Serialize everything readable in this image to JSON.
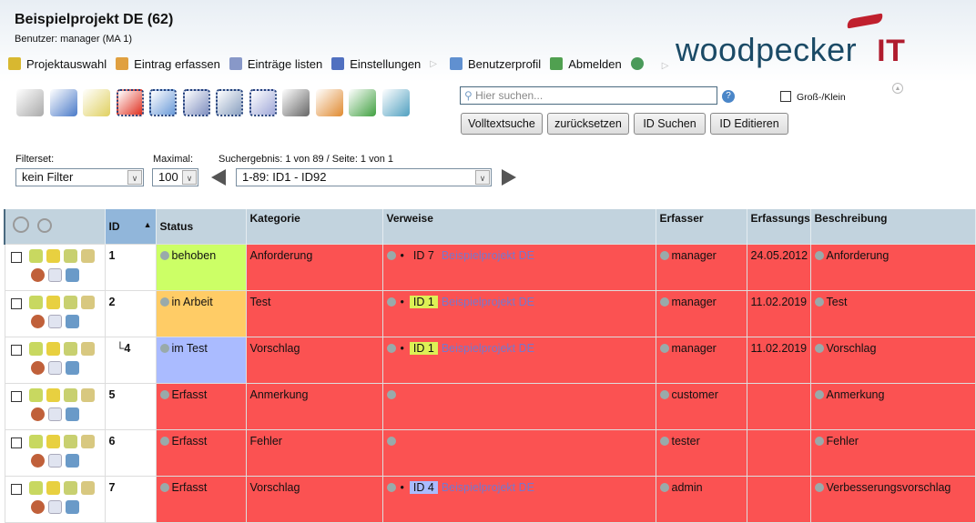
{
  "header": {
    "title": "Beispielprojekt DE (62)",
    "user": "Benutzer: manager (MA 1)",
    "logo_text": "woodpecker",
    "logo_suffix": "IT"
  },
  "menu": [
    {
      "label": "Projektauswahl",
      "icon": "folder-icon"
    },
    {
      "label": "Eintrag erfassen",
      "icon": "add-entry-icon"
    },
    {
      "label": "Einträge listen",
      "icon": "grid-icon"
    },
    {
      "label": "Einstellungen",
      "icon": "settings-icon"
    },
    {
      "label": "Benutzerprofil",
      "icon": "profile-icon"
    },
    {
      "label": "Abmelden",
      "icon": "logout-icon"
    }
  ],
  "toolbar": [
    "filter-icon",
    "select-icon",
    "edit-icon",
    "delete-icon",
    "attach-icon",
    "copy-icon",
    "print-icon",
    "mail-icon",
    "mailbox-icon",
    "import-icon",
    "export-icon",
    "chart-icon"
  ],
  "search": {
    "placeholder": "Hier suchen...",
    "case_label": "Groß-/Klein",
    "buttons": [
      "Volltextsuche",
      "zurücksetzen",
      "ID Suchen",
      "ID Editieren"
    ]
  },
  "filters": {
    "filterset_label": "Filterset:",
    "filterset_value": "kein Filter",
    "max_label": "Maximal:",
    "max_value": "100",
    "result_label": "Suchergebnis:  1 von 89 / Seite: 1 von 1",
    "range_value": "1-89: ID1 - ID92"
  },
  "table": {
    "columns": [
      "ID",
      "Status",
      "Kategorie",
      "Verweise",
      "Erfasser",
      "Erfassungs",
      "Beschreibung"
    ],
    "sort_indicator": "▲",
    "rows": [
      {
        "id": "1",
        "status": "behoben",
        "status_color": "#ccff66",
        "kategorie": "Anforderung",
        "ref_id": "ID 7",
        "ref_color": "",
        "ref_project": "Beispielprojekt DE",
        "erfasser": "manager",
        "datum": "24.05.2012",
        "beschreibung": "Anforderung"
      },
      {
        "id": "2",
        "status": "in Arbeit",
        "status_color": "#ffcc66",
        "kategorie": "Test",
        "ref_id": "ID 1",
        "ref_color": "#ddf055",
        "ref_project": "Beispielprojekt DE",
        "erfasser": "manager",
        "datum": "11.02.2019",
        "beschreibung": "Test"
      },
      {
        "id": "└4",
        "status": "im Test",
        "status_color": "#aabbff",
        "kategorie": "Vorschlag",
        "ref_id": "ID 1",
        "ref_color": "#ddf055",
        "ref_project": "Beispielprojekt DE",
        "erfasser": "manager",
        "datum": "11.02.2019",
        "beschreibung": "Vorschlag"
      },
      {
        "id": "5",
        "status": "Erfasst",
        "status_color": "#fb5252",
        "kategorie": "Anmerkung",
        "ref_id": "",
        "ref_color": "",
        "ref_project": "",
        "erfasser": "customer",
        "datum": "",
        "beschreibung": "Anmerkung"
      },
      {
        "id": "6",
        "status": "Erfasst",
        "status_color": "#fb5252",
        "kategorie": "Fehler",
        "ref_id": "",
        "ref_color": "",
        "ref_project": "",
        "erfasser": "tester",
        "datum": "",
        "beschreibung": "Fehler"
      },
      {
        "id": "7",
        "status": "Erfasst",
        "status_color": "#fb5252",
        "kategorie": "Vorschlag",
        "ref_id": "ID 4",
        "ref_color": "#aabbff",
        "ref_project": "Beispielprojekt DE",
        "erfasser": "admin",
        "datum": "",
        "beschreibung": "Verbesserungsvorschlag"
      }
    ]
  }
}
